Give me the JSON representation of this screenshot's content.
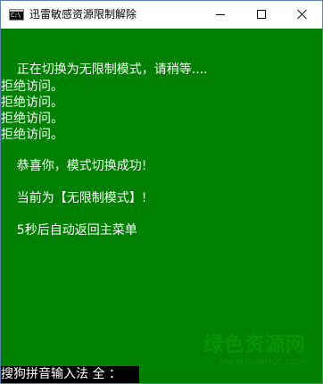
{
  "window": {
    "title": "迅雷敏感资源限制解除",
    "icon_name": "console-app-icon",
    "icon_text": "C:\\"
  },
  "console": {
    "lines": [
      "    正在切换为无限制模式，请稍等....",
      "拒绝访问。",
      "拒绝访问。",
      "拒绝访问。",
      "拒绝访问。",
      "    恭喜你，模式切换成功!",
      "    当前为【无限制模式】!",
      "    5秒后自动返回主菜单"
    ]
  },
  "watermark": {
    "brand": "绿色资源网",
    "url": "www.downcc.com"
  },
  "ime": {
    "status": "搜狗拼音输入法 全 ："
  },
  "colors": {
    "console_background": "#008000",
    "console_text": "#ffffff",
    "titlebar_background": "#ffffff",
    "watermark": "#0a9a0a"
  }
}
